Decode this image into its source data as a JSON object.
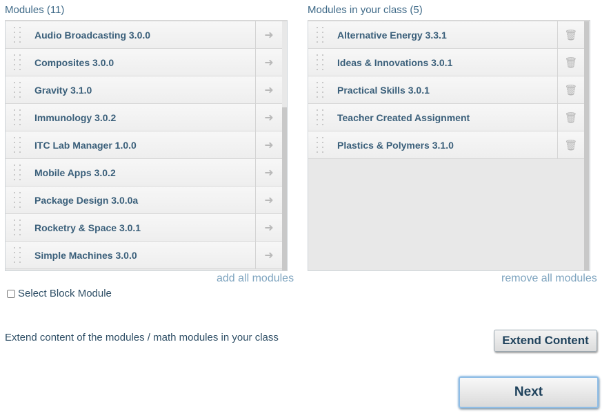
{
  "available": {
    "heading": "Modules (11)",
    "items": [
      {
        "label": "Audio Broadcasting 3.0.0"
      },
      {
        "label": "Composites 3.0.0"
      },
      {
        "label": "Gravity 3.1.0"
      },
      {
        "label": "Immunology 3.0.2"
      },
      {
        "label": "ITC Lab Manager 1.0.0"
      },
      {
        "label": "Mobile Apps 3.0.2"
      },
      {
        "label": "Package Design 3.0.0a"
      },
      {
        "label": "Rocketry & Space 3.0.1"
      },
      {
        "label": "Simple Machines 3.0.0"
      }
    ],
    "add_all_label": "add all modules",
    "add_icon": "arrow-right-icon"
  },
  "selected": {
    "heading": "Modules in your class (5)",
    "items": [
      {
        "label": "Alternative Energy 3.3.1"
      },
      {
        "label": "Ideas & Innovations 3.0.1"
      },
      {
        "label": "Practical Skills 3.0.1"
      },
      {
        "label": "Teacher Created Assignment"
      },
      {
        "label": "Plastics & Polymers 3.1.0"
      }
    ],
    "remove_all_label": "remove all modules",
    "remove_icon": "trash-icon"
  },
  "block_module": {
    "label": "Select Block Module",
    "checked": false
  },
  "extend": {
    "text": "Extend content of the modules / math modules in your class",
    "button_label": "Extend Content"
  },
  "next_label": "Next",
  "colors": {
    "text_primary": "#3a5f7a",
    "link": "#7ea4bf",
    "focus_ring": "#8fbde6"
  }
}
